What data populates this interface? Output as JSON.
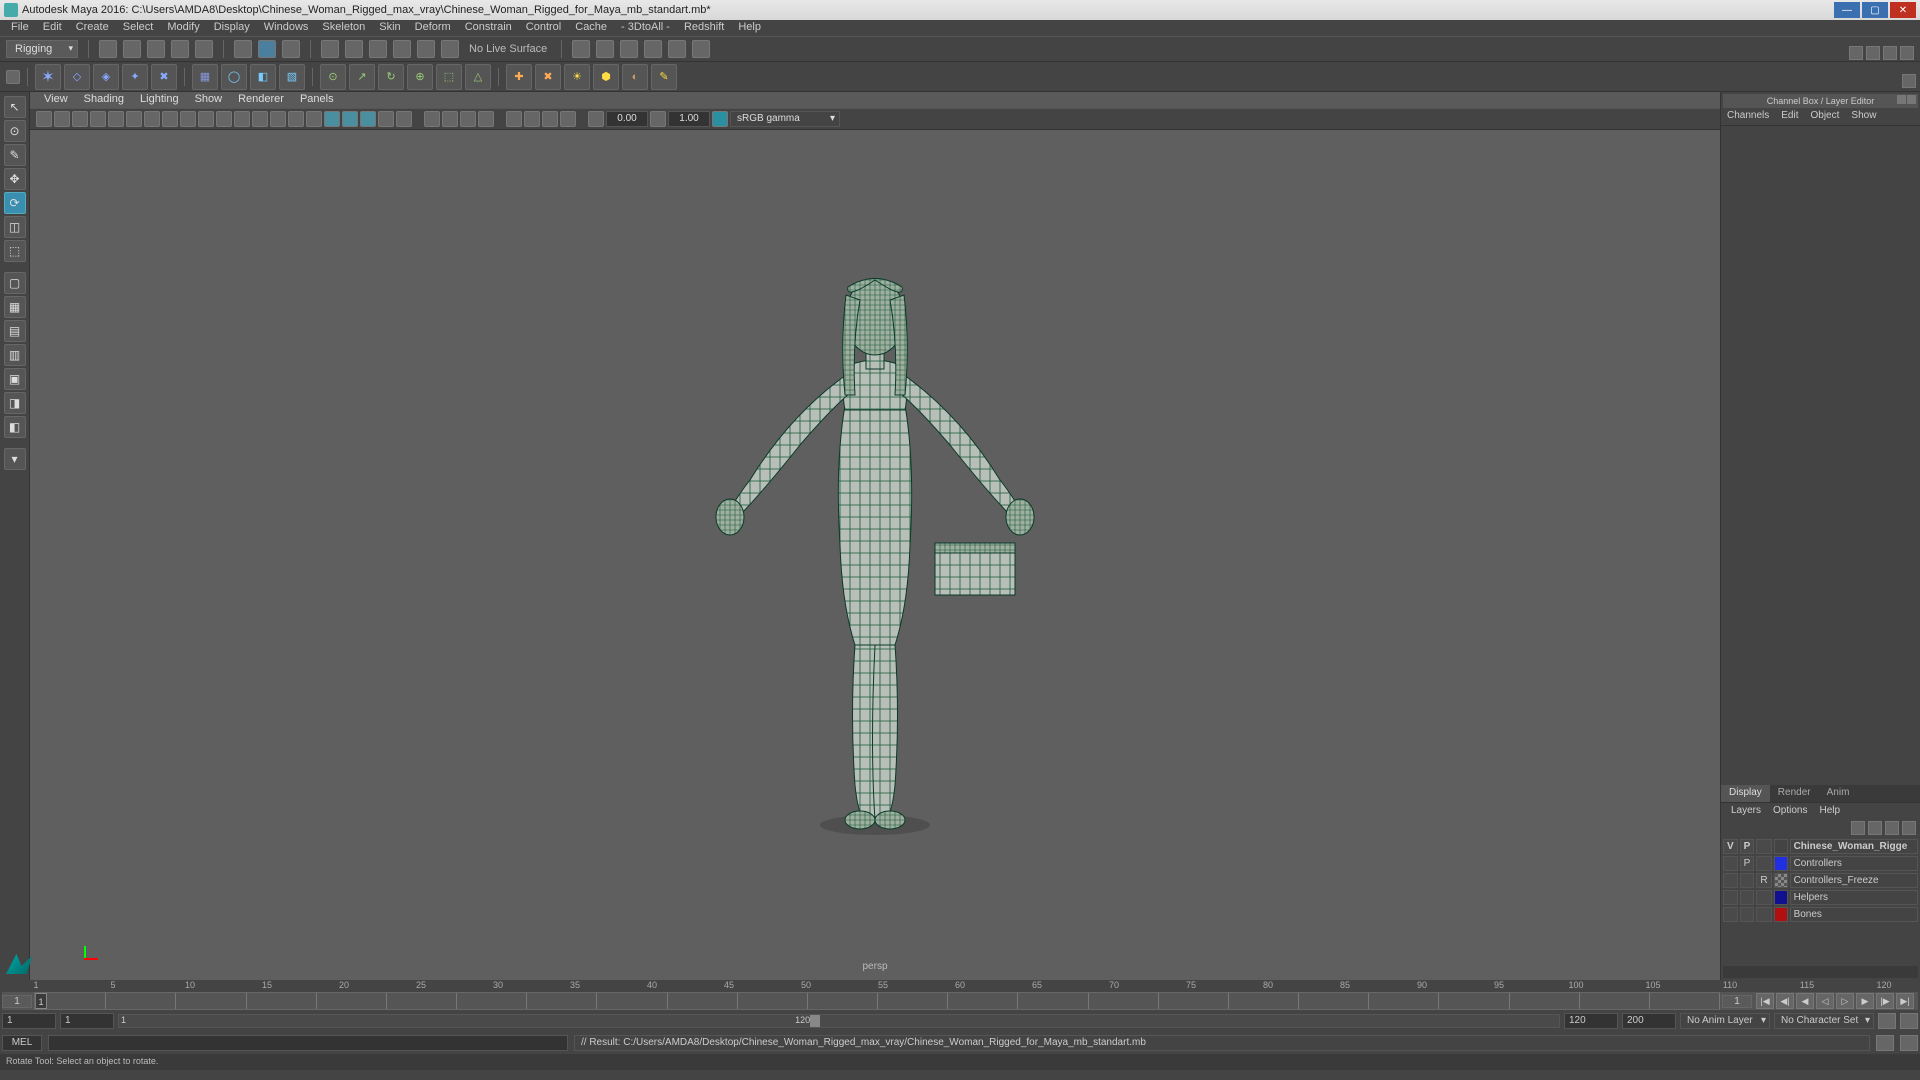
{
  "titlebar": {
    "text": "Autodesk Maya 2016: C:\\Users\\AMDA8\\Desktop\\Chinese_Woman_Rigged_max_vray\\Chinese_Woman_Rigged_for_Maya_mb_standart.mb*"
  },
  "menubar": [
    "File",
    "Edit",
    "Create",
    "Select",
    "Modify",
    "Display",
    "Windows",
    "Skeleton",
    "Skin",
    "Deform",
    "Constrain",
    "Control",
    "Cache",
    "- 3DtoAll -",
    "Redshift",
    "Help"
  ],
  "shelf": {
    "mode": "Rigging",
    "surface_label": "No Live Surface"
  },
  "viewport": {
    "menus": [
      "View",
      "Shading",
      "Lighting",
      "Show",
      "Renderer",
      "Panels"
    ],
    "num1": "0.00",
    "num2": "1.00",
    "colorspace": "sRGB gamma",
    "camera": "persp"
  },
  "rightpanel": {
    "title": "Channel Box / Layer Editor",
    "tabs": [
      "Channels",
      "Edit",
      "Object",
      "Show"
    ],
    "bottom_tabs": [
      "Display",
      "Render",
      "Anim"
    ],
    "btmenu": [
      "Layers",
      "Options",
      "Help"
    ],
    "layer_head": {
      "v": "V",
      "p": "P"
    },
    "layers": [
      {
        "v": "",
        "p": "P",
        "r": "",
        "swatch": "swatch-blue",
        "name": "Chinese_Woman_Rigge"
      },
      {
        "v": "",
        "p": "P",
        "r": "",
        "swatch": "swatch-blue",
        "name": "Controllers"
      },
      {
        "v": "",
        "p": "",
        "r": "R",
        "swatch": "swatch-check",
        "name": "Controllers_Freeze"
      },
      {
        "v": "",
        "p": "",
        "r": "",
        "swatch": "swatch-navy",
        "name": "Helpers"
      },
      {
        "v": "",
        "p": "",
        "r": "",
        "swatch": "swatch-red",
        "name": "Bones"
      }
    ]
  },
  "timeline": {
    "start_display": "1",
    "ticks": [
      "1",
      "5",
      "10",
      "15",
      "20",
      "25",
      "30",
      "35",
      "40",
      "45",
      "50",
      "55",
      "60",
      "65",
      "70",
      "75",
      "80",
      "85",
      "90",
      "95",
      "100",
      "105",
      "110",
      "115",
      "120"
    ],
    "end_display": "1",
    "playhead": "1"
  },
  "range": {
    "start1": "1",
    "start2": "1",
    "end1": "120",
    "end2": "200",
    "anim_layer": "No Anim Layer",
    "char_set": "No Character Set",
    "slider_label": "1",
    "slider_end": "120"
  },
  "cmd": {
    "lang": "MEL",
    "result": "// Result: C:/Users/AMDA8/Desktop/Chinese_Woman_Rigged_max_vray/Chinese_Woman_Rigged_for_Maya_mb_standart.mb"
  },
  "help": "Rotate Tool: Select an object to rotate."
}
